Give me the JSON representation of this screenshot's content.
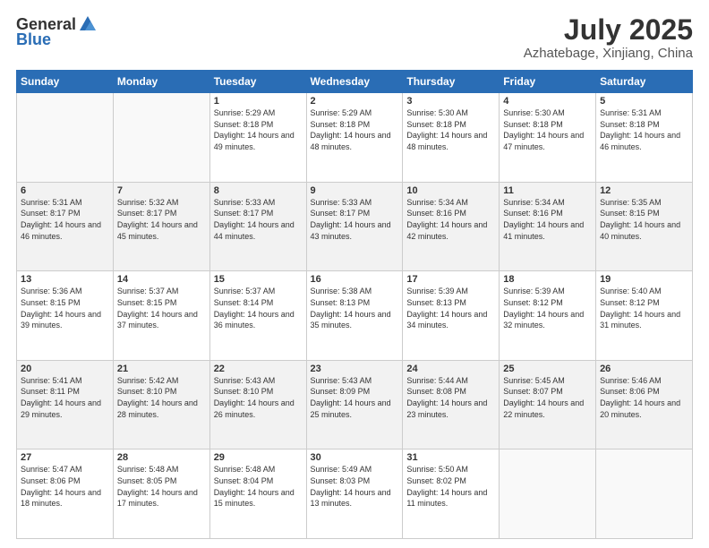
{
  "logo": {
    "general": "General",
    "blue": "Blue"
  },
  "title": "July 2025",
  "subtitle": "Azhatebage, Xinjiang, China",
  "weekdays": [
    "Sunday",
    "Monday",
    "Tuesday",
    "Wednesday",
    "Thursday",
    "Friday",
    "Saturday"
  ],
  "weeks": [
    [
      {
        "day": "",
        "info": ""
      },
      {
        "day": "",
        "info": ""
      },
      {
        "day": "1",
        "info": "Sunrise: 5:29 AM\nSunset: 8:18 PM\nDaylight: 14 hours and 49 minutes."
      },
      {
        "day": "2",
        "info": "Sunrise: 5:29 AM\nSunset: 8:18 PM\nDaylight: 14 hours and 48 minutes."
      },
      {
        "day": "3",
        "info": "Sunrise: 5:30 AM\nSunset: 8:18 PM\nDaylight: 14 hours and 48 minutes."
      },
      {
        "day": "4",
        "info": "Sunrise: 5:30 AM\nSunset: 8:18 PM\nDaylight: 14 hours and 47 minutes."
      },
      {
        "day": "5",
        "info": "Sunrise: 5:31 AM\nSunset: 8:18 PM\nDaylight: 14 hours and 46 minutes."
      }
    ],
    [
      {
        "day": "6",
        "info": "Sunrise: 5:31 AM\nSunset: 8:17 PM\nDaylight: 14 hours and 46 minutes."
      },
      {
        "day": "7",
        "info": "Sunrise: 5:32 AM\nSunset: 8:17 PM\nDaylight: 14 hours and 45 minutes."
      },
      {
        "day": "8",
        "info": "Sunrise: 5:33 AM\nSunset: 8:17 PM\nDaylight: 14 hours and 44 minutes."
      },
      {
        "day": "9",
        "info": "Sunrise: 5:33 AM\nSunset: 8:17 PM\nDaylight: 14 hours and 43 minutes."
      },
      {
        "day": "10",
        "info": "Sunrise: 5:34 AM\nSunset: 8:16 PM\nDaylight: 14 hours and 42 minutes."
      },
      {
        "day": "11",
        "info": "Sunrise: 5:34 AM\nSunset: 8:16 PM\nDaylight: 14 hours and 41 minutes."
      },
      {
        "day": "12",
        "info": "Sunrise: 5:35 AM\nSunset: 8:15 PM\nDaylight: 14 hours and 40 minutes."
      }
    ],
    [
      {
        "day": "13",
        "info": "Sunrise: 5:36 AM\nSunset: 8:15 PM\nDaylight: 14 hours and 39 minutes."
      },
      {
        "day": "14",
        "info": "Sunrise: 5:37 AM\nSunset: 8:15 PM\nDaylight: 14 hours and 37 minutes."
      },
      {
        "day": "15",
        "info": "Sunrise: 5:37 AM\nSunset: 8:14 PM\nDaylight: 14 hours and 36 minutes."
      },
      {
        "day": "16",
        "info": "Sunrise: 5:38 AM\nSunset: 8:13 PM\nDaylight: 14 hours and 35 minutes."
      },
      {
        "day": "17",
        "info": "Sunrise: 5:39 AM\nSunset: 8:13 PM\nDaylight: 14 hours and 34 minutes."
      },
      {
        "day": "18",
        "info": "Sunrise: 5:39 AM\nSunset: 8:12 PM\nDaylight: 14 hours and 32 minutes."
      },
      {
        "day": "19",
        "info": "Sunrise: 5:40 AM\nSunset: 8:12 PM\nDaylight: 14 hours and 31 minutes."
      }
    ],
    [
      {
        "day": "20",
        "info": "Sunrise: 5:41 AM\nSunset: 8:11 PM\nDaylight: 14 hours and 29 minutes."
      },
      {
        "day": "21",
        "info": "Sunrise: 5:42 AM\nSunset: 8:10 PM\nDaylight: 14 hours and 28 minutes."
      },
      {
        "day": "22",
        "info": "Sunrise: 5:43 AM\nSunset: 8:10 PM\nDaylight: 14 hours and 26 minutes."
      },
      {
        "day": "23",
        "info": "Sunrise: 5:43 AM\nSunset: 8:09 PM\nDaylight: 14 hours and 25 minutes."
      },
      {
        "day": "24",
        "info": "Sunrise: 5:44 AM\nSunset: 8:08 PM\nDaylight: 14 hours and 23 minutes."
      },
      {
        "day": "25",
        "info": "Sunrise: 5:45 AM\nSunset: 8:07 PM\nDaylight: 14 hours and 22 minutes."
      },
      {
        "day": "26",
        "info": "Sunrise: 5:46 AM\nSunset: 8:06 PM\nDaylight: 14 hours and 20 minutes."
      }
    ],
    [
      {
        "day": "27",
        "info": "Sunrise: 5:47 AM\nSunset: 8:06 PM\nDaylight: 14 hours and 18 minutes."
      },
      {
        "day": "28",
        "info": "Sunrise: 5:48 AM\nSunset: 8:05 PM\nDaylight: 14 hours and 17 minutes."
      },
      {
        "day": "29",
        "info": "Sunrise: 5:48 AM\nSunset: 8:04 PM\nDaylight: 14 hours and 15 minutes."
      },
      {
        "day": "30",
        "info": "Sunrise: 5:49 AM\nSunset: 8:03 PM\nDaylight: 14 hours and 13 minutes."
      },
      {
        "day": "31",
        "info": "Sunrise: 5:50 AM\nSunset: 8:02 PM\nDaylight: 14 hours and 11 minutes."
      },
      {
        "day": "",
        "info": ""
      },
      {
        "day": "",
        "info": ""
      }
    ]
  ]
}
